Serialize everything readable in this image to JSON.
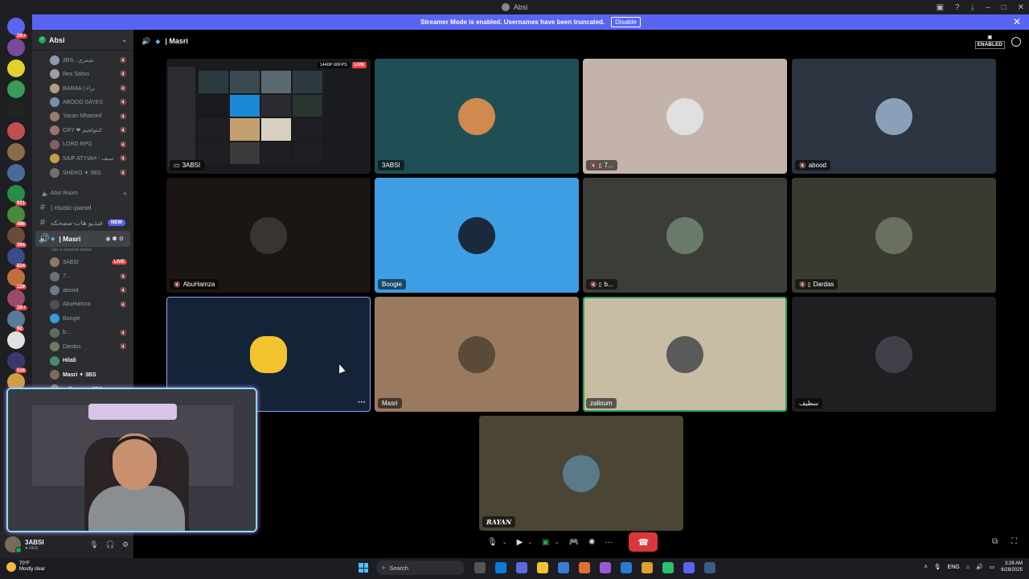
{
  "window": {
    "title": "Absi"
  },
  "banner": {
    "text": "Streamer Mode is enabled. Usernames have been truncated.",
    "disable_label": "Disable",
    "color": "#5865f2"
  },
  "rail_badges": [
    "1K+",
    "",
    "",
    "",
    "",
    "",
    "",
    "",
    "921",
    "486",
    "394",
    "824",
    "129",
    "1K+",
    "92",
    "",
    "518",
    ""
  ],
  "server": {
    "name": "Absi"
  },
  "top_voice_users": [
    {
      "name": "3BS . شمري",
      "color": "#8e9ab0"
    },
    {
      "name": "Rex Sahro",
      "color": "#a0a0a0"
    },
    {
      "name": "BARAA | براء",
      "color": "#b0a080"
    },
    {
      "name": "ABOOD SAYES",
      "color": "#7a8fa8"
    },
    {
      "name": "Yazan Mhamed",
      "color": "#9a7a6a"
    },
    {
      "name": "CRY ❤ كنتولجيم",
      "color": "#a07070"
    },
    {
      "name": "LORD RPG",
      "color": "#806060"
    },
    {
      "name": "SAIF ATYIAH - سيف",
      "color": "#c0a040"
    },
    {
      "name": "SHEKO ✦ 3BS",
      "color": "#707070"
    }
  ],
  "category": {
    "name": "Absi Room"
  },
  "channels": [
    {
      "icon": "#",
      "name": "| music-panel"
    },
    {
      "icon": "#",
      "name": "فيديو هات-مضحكه",
      "badge": "NEW"
    }
  ],
  "active_channel": {
    "name": "| Masri",
    "status_hint": "Set a channel status"
  },
  "channel_users": [
    {
      "name": "3ABSI",
      "live": "LIVE",
      "color": "#8a7a6a"
    },
    {
      "name": "7...",
      "color": "#707070"
    },
    {
      "name": "abood",
      "color": "#6a7a8a"
    },
    {
      "name": "AbuHamza",
      "color": "#505050"
    },
    {
      "name": "Boogie",
      "color": "#3a9bdc"
    },
    {
      "name": "b...",
      "color": "#606a60"
    },
    {
      "name": "Dardas",
      "color": "#707860"
    },
    {
      "name": "Hilali",
      "color": "#4a8a6a"
    },
    {
      "name": "Masri ✦ 3BS",
      "color": "#806a5a"
    },
    {
      "name": "zalloum ✦ 3BS",
      "color": "#8a8070"
    }
  ],
  "user_panel": {
    "name": "3ABSI",
    "sub": "● Absi"
  },
  "header": {
    "channel_name": "| Masri",
    "enabled_label": "ENABLED"
  },
  "share_tile": {
    "name": "3ABSI",
    "resolution": "1440P 60FPS",
    "live": "LIVE"
  },
  "tiles": [
    {
      "name": "3ABSI",
      "bg": "#1f4f55",
      "avatar": "#d08a50"
    },
    {
      "name": "7...",
      "bg": "#c4b3aa",
      "avatar": "#e0e0e0",
      "icons": "🔇 ▯"
    },
    {
      "name": "abood",
      "bg": "#2b3440",
      "avatar": "#8aa0b8",
      "icons": "🔇"
    },
    {
      "name": "AbuHamza",
      "bg": "#1b1614",
      "avatar": "#3a3430",
      "icons": "🔇"
    },
    {
      "name": "Boogie",
      "bg": "#3d9ee4",
      "avatar": "#1a2a3a"
    },
    {
      "name": "b...",
      "bg": "#3a3d38",
      "avatar": "#6a7a6a",
      "icons": "🔇 ▯"
    },
    {
      "name": "Dardas",
      "bg": "#3a3b30",
      "avatar": "#6a7060",
      "icons": "🔇 ▯"
    },
    {
      "name": "",
      "bg": "#142338",
      "avatar": "#f4c430",
      "selected": true,
      "more": "···"
    },
    {
      "name": "Masri",
      "bg": "#9a7a5e",
      "avatar": "#5a4a3a"
    },
    {
      "name": "zalloum",
      "bg": "#c8bca4",
      "avatar": "#5a5a5a",
      "speaking": true
    },
    {
      "name": "سطيف",
      "bg": "#1f1f22",
      "avatar": "#404048"
    },
    {
      "name": "RAYAN",
      "bg": "#4a4534",
      "avatar": "#5a7a8a"
    }
  ],
  "time": {
    "clock": "3:28 AM",
    "date": "6/28/2025",
    "lang": "ENG"
  },
  "weather": {
    "temp": "70°F",
    "desc": "Mostly clear"
  },
  "taskbar": {
    "search_label": "Search"
  }
}
